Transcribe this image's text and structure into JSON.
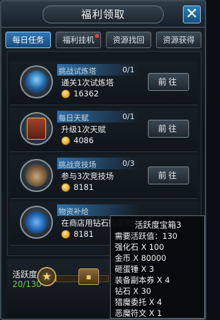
{
  "window": {
    "title": "福利领取"
  },
  "tabs": [
    {
      "label": "每日任务",
      "active": true
    },
    {
      "label": "福利挂机",
      "has_dot": true
    },
    {
      "label": "资源找回"
    },
    {
      "label": "资源获得"
    }
  ],
  "tasks": [
    {
      "title": "挑战试炼塔",
      "progress": "0/1",
      "desc": "通关1次试炼塔",
      "reward": "16362",
      "button": "前往",
      "icon": "tower-icon"
    },
    {
      "title": "每日天赋",
      "progress": "0/1",
      "desc": "升级1次天赋",
      "reward": "4086",
      "button": "前往",
      "icon": "talent-book-icon"
    },
    {
      "title": "挑战竞技场",
      "progress": "0/3",
      "desc": "参与3次竞技场",
      "reward": "8181",
      "button": "前往",
      "icon": "arena-icon"
    },
    {
      "title": "物资补给",
      "progress": "",
      "desc": "在商店用钻石购买物品",
      "reward": "8181",
      "button": "",
      "icon": "supply-bag-icon"
    }
  ],
  "footer": {
    "activity_label": "活跃度",
    "activity_value": "20/130",
    "progress_fraction": 0.15
  },
  "tooltip": {
    "title": "活跃度宝箱3",
    "lines": [
      "需要活跃值：130",
      "强化石 X 100",
      "金币 X 80000",
      "砸蛋锤 X 3",
      "装备副本券 X 4",
      "钻石 X 30",
      "猎魔委托 X 4",
      "恶魔符文 X 1"
    ]
  },
  "colors": {
    "accent_blue": "#2f78b8",
    "activity_green": "#5ed04d",
    "coin_gold": "#e0a92a"
  }
}
